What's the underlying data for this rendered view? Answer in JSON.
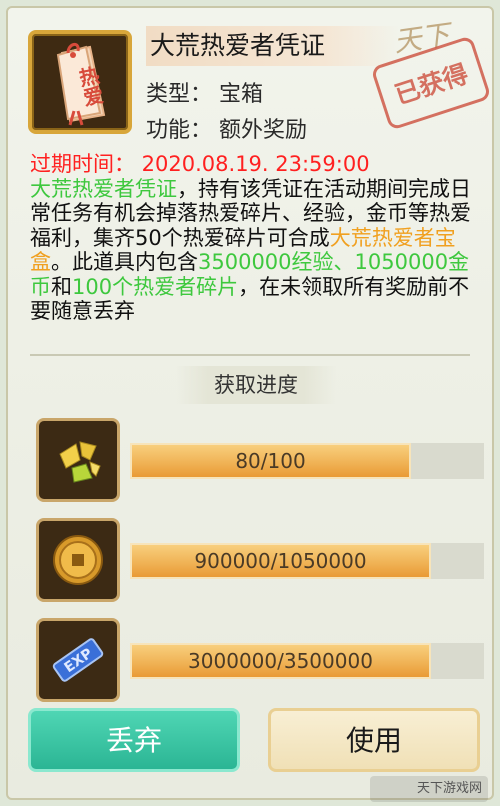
{
  "item": {
    "name": "大荒热爱者凭证",
    "tag_text": "热爱",
    "type_label": "类型：",
    "type_value": "宝箱",
    "function_label": "功能：",
    "function_value": "额外奖励",
    "stamp": "已获得",
    "logo_text": "天下"
  },
  "description": {
    "expiry": "过期时间： 2020.08.19. 23:59:00",
    "p1_name": "大荒热爱者凭证",
    "p2": "，持有该凭证在活动期间完成日常任务有机会掉落热爱碎片、经验，金币等热爱福利，集齐50个热爱碎片可合成",
    "p3_box": "大荒热爱者宝盒",
    "p4": "。此道具内包含",
    "p5_exp": "3500000经验",
    "p6": "、",
    "p7_gold": "1050000金币",
    "p8": "和",
    "p9_frag": "100个热爱者碎片",
    "p10": "，在未领取所有奖励前不要随意丢弃"
  },
  "progress": {
    "title": "获取进度",
    "rows": [
      {
        "icon": "fragment-icon",
        "text": "80/100",
        "fraction": 0.8
      },
      {
        "icon": "gold-coin-icon",
        "text": "900000/1050000",
        "fraction": 0.857
      },
      {
        "icon": "exp-icon",
        "text": "3000000/3500000",
        "fraction": 0.857
      }
    ]
  },
  "buttons": {
    "discard": "丢弃",
    "use": "使用"
  },
  "watermark": "天下游戏网",
  "colors": {
    "expiry_red": "#ff2020",
    "highlight_green": "#3ec83e",
    "highlight_orange": "#f0a020",
    "progress_orange": "#f0b356",
    "discard_teal": "#2bb594"
  }
}
